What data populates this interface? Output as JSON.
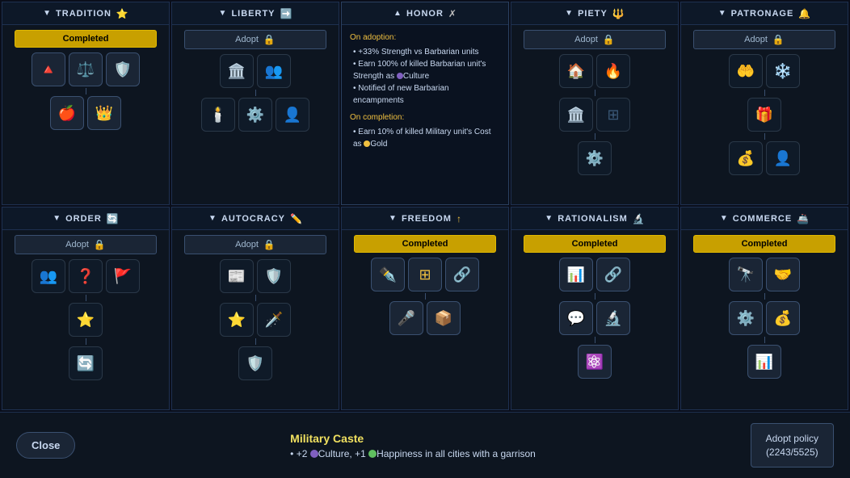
{
  "trees": {
    "row1": [
      {
        "id": "tradition",
        "title": "TRADITION",
        "header_icon": "⭐",
        "arrow": "▼",
        "status": "completed",
        "status_label": "Completed",
        "icons_top": [
          "🔺",
          "⚖️",
          "🛡️"
        ],
        "icons_bottom": [
          "🍎",
          "👑"
        ]
      },
      {
        "id": "liberty",
        "title": "LIBERTY",
        "header_icon": "➡️",
        "arrow": "▼",
        "status": "adopt",
        "status_label": "Adopt",
        "locked": true,
        "icons_row1": [
          "🏛️",
          "👥"
        ],
        "icons_row2": [
          "🕯️",
          "⚙️",
          "👤"
        ]
      },
      {
        "id": "honor",
        "title": "HONOR",
        "header_icon": "✗",
        "arrow": "▲",
        "status": "tooltip",
        "tooltip": {
          "adoption_title": "On adoption:",
          "adoption_items": [
            "+33% Strength vs Barbarian units",
            "Earn 100% of killed Barbarian unit's Strength as 🔵Culture",
            "Notified of new Barbarian encampments"
          ],
          "completion_title": "On completion:",
          "completion_items": [
            "Earn 10% of killed Military unit's Cost as 🟡Gold"
          ]
        }
      },
      {
        "id": "piety",
        "title": "PIETY",
        "header_icon": "🔱",
        "arrow": "▼",
        "status": "adopt",
        "status_label": "Adopt",
        "locked": true,
        "icons_row1": [
          "🏠",
          "🔥"
        ],
        "icons_row2": [
          "🏛️",
          "⊞"
        ],
        "icons_row3": [
          "⚙️"
        ]
      },
      {
        "id": "patronage",
        "title": "PATRONAGE",
        "header_icon": "🔔",
        "arrow": "▼",
        "status": "adopt",
        "status_label": "Adopt",
        "locked": true,
        "icons_row1": [
          "🤲",
          "❄️"
        ],
        "icons_row2": [
          "🎁"
        ],
        "icons_row3": [
          "💰",
          "👤"
        ]
      }
    ],
    "row2": [
      {
        "id": "order",
        "title": "ORDER",
        "header_icon": "🔄",
        "arrow": "▼",
        "status": "adopt",
        "status_label": "Adopt",
        "locked": true,
        "icons_row1": [
          "👥",
          "❓",
          "🚩"
        ],
        "icons_row2": [
          "⭐"
        ],
        "icons_row3": [
          "🔄"
        ]
      },
      {
        "id": "autocracy",
        "title": "AUTOCRACY",
        "header_icon": "✏️",
        "arrow": "▼",
        "status": "adopt",
        "status_label": "Adopt",
        "locked": true,
        "icons_row1": [
          "📰",
          "🛡️"
        ],
        "icons_row2": [
          "⭐",
          "🗡️"
        ],
        "icons_row3": [
          "🛡️"
        ]
      },
      {
        "id": "freedom",
        "title": "FREEDOM",
        "header_icon": "↑",
        "arrow": "▼",
        "status": "completed",
        "status_label": "Completed",
        "icons_row1": [
          "✒️",
          "⊞",
          "🔗"
        ],
        "icons_row2": [
          "🎤",
          "📦"
        ]
      },
      {
        "id": "rationalism",
        "title": "RATIONALISM",
        "header_icon": "🔬",
        "arrow": "▼",
        "status": "completed",
        "status_label": "Completed",
        "icons_row1": [
          "📊",
          "🔗"
        ],
        "icons_row2": [
          "💬",
          "🔬"
        ],
        "icons_row3": [
          "⚛️"
        ]
      },
      {
        "id": "commerce",
        "title": "COMMERCE",
        "header_icon": "🚢",
        "arrow": "▼",
        "status": "completed",
        "status_label": "Completed",
        "icons_row1": [
          "🔭",
          "🤝"
        ],
        "icons_row2": [
          "⚙️",
          "💰"
        ],
        "icons_row3": [
          "📊"
        ]
      }
    ]
  },
  "bottom_bar": {
    "close_label": "Close",
    "info_title": "Military Caste",
    "info_desc": "• +2 🔵Culture, +1 😊Happiness in all cities with a garrison",
    "adopt_policy_label": "Adopt policy\n(2243/5525)"
  }
}
